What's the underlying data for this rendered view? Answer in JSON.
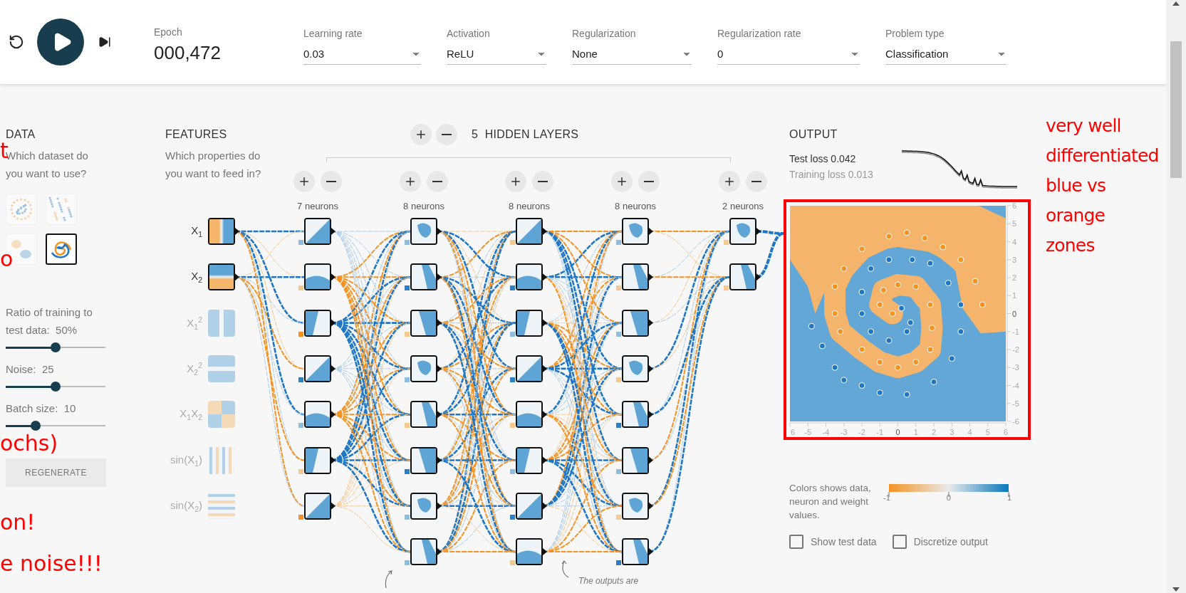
{
  "toolbar": {
    "epoch_label": "Epoch",
    "epoch": "000,472",
    "dropdowns": [
      {
        "label": "Learning rate",
        "value": "0.03"
      },
      {
        "label": "Activation",
        "value": "ReLU"
      },
      {
        "label": "Regularization",
        "value": "None"
      },
      {
        "label": "Regularization rate",
        "value": "0"
      },
      {
        "label": "Problem type",
        "value": "Classification"
      }
    ]
  },
  "data_panel": {
    "title": "DATA",
    "question": "Which dataset do you want to use?",
    "datasets": [
      {
        "kind": "circle",
        "selected": false
      },
      {
        "kind": "xor",
        "selected": false
      },
      {
        "kind": "gauss",
        "selected": false
      },
      {
        "kind": "spiral",
        "selected": true
      }
    ],
    "sliders": [
      {
        "label": "Ratio of training to test data:",
        "value": "50%",
        "level": 0.5
      },
      {
        "label": "Noise:",
        "value": "25",
        "level": 0.5
      },
      {
        "label": "Batch size:",
        "value": "10",
        "level": 0.3
      }
    ],
    "regenerate": "REGENERATE"
  },
  "features": {
    "title": "FEATURES",
    "question": "Which properties do you want to feed in?",
    "items": [
      {
        "label": "X$_{1}$",
        "kind": "x1",
        "selected": true
      },
      {
        "label": "X$_{2}$",
        "kind": "x2",
        "selected": true
      },
      {
        "label": "X$_{1}$$^{2}$",
        "kind": "x1sq",
        "selected": false
      },
      {
        "label": "X$_{2}$$^{2}$",
        "kind": "x2sq",
        "selected": false
      },
      {
        "label": "X$_{1}$X$_{2}$",
        "kind": "x1x2",
        "selected": false
      },
      {
        "label": "sin(X$_{1}$)",
        "kind": "sinx1",
        "selected": false
      },
      {
        "label": "sin(X$_{2}$)",
        "kind": "sinx2",
        "selected": false
      }
    ]
  },
  "hidden_layers": {
    "count": "5",
    "title": "HIDDEN LAYERS",
    "layers": [
      {
        "neurons": "7 neurons",
        "nodes": [
          {
            "color": "#8fbde0"
          },
          {
            "color": "#f5c890"
          },
          {
            "color": "#f59322"
          },
          {
            "color": "#2f7fc1"
          },
          {
            "color": "#8fbde0"
          },
          {
            "color": "#f5c890"
          },
          {
            "color": "#f59322"
          }
        ]
      },
      {
        "neurons": "8 neurons",
        "nodes": [
          {
            "color": "#8fbde0"
          },
          {
            "color": "#2f7fc1"
          },
          {
            "color": "#f5c890"
          },
          {
            "color": "#8fbde0"
          },
          {
            "color": "#f5c890"
          },
          {
            "color": "#2f7fc1"
          },
          {
            "color": "#8fbde0"
          },
          {
            "color": "#8fbde0"
          }
        ]
      },
      {
        "neurons": "8 neurons",
        "nodes": [
          {
            "color": "#f5c890"
          },
          {
            "color": "#2f7fc1"
          },
          {
            "color": "#8fbde0"
          },
          {
            "color": "#2f7fc1"
          },
          {
            "color": "#f5c890"
          },
          {
            "color": "#8fbde0"
          },
          {
            "color": "#2f7fc1"
          },
          {
            "color": "#f5c890"
          }
        ]
      },
      {
        "neurons": "8 neurons",
        "nodes": [
          {
            "color": "#8fbde0"
          },
          {
            "color": "#f5c890"
          },
          {
            "color": "#8fbde0"
          },
          {
            "color": "#f5c890"
          },
          {
            "color": "#2f7fc1"
          },
          {
            "color": "#8fbde0"
          },
          {
            "color": "#f5c890"
          },
          {
            "color": "#2f7fc1"
          }
        ]
      },
      {
        "neurons": "2 neurons",
        "nodes": [
          {
            "color": "#f5c890"
          },
          {
            "color": "#f5c890"
          }
        ]
      }
    ],
    "note": "The outputs are"
  },
  "output": {
    "title": "OUTPUT",
    "test_loss": "Test loss 0.042",
    "training_loss": "Training loss 0.013",
    "chart_data": {
      "type": "scatter",
      "xlim": [
        -6,
        6
      ],
      "ylim": [
        -6,
        6
      ],
      "xticks": [
        {
          "value": -6,
          "label": "6"
        },
        -5,
        -4,
        -3,
        -2,
        -1,
        0,
        1,
        2,
        3,
        4,
        5,
        6
      ],
      "yticks": [
        -6,
        -5,
        -4,
        -3,
        -2,
        -1,
        0,
        1,
        2,
        3,
        4,
        5,
        6
      ],
      "series": [
        {
          "color": "#f59322",
          "x": [
            -0.3,
            -1,
            -0.8,
            0,
            1,
            1.8,
            1.9,
            1.8,
            1,
            0,
            -1,
            -2,
            -3.2,
            -3.5,
            -3.5,
            -3,
            -2,
            -0.5,
            0.5,
            1.5,
            2.5,
            3.5,
            4.3,
            4.7
          ],
          "values": [
            0,
            0.5,
            1.3,
            1.6,
            1.5,
            0.5,
            -0.8,
            -2,
            -2.7,
            -3,
            -2.7,
            -2,
            -1,
            0,
            1.5,
            2.5,
            3.6,
            4.3,
            4.5,
            4.2,
            3.7,
            3,
            1.8,
            0.5
          ]
        },
        {
          "color": "#1f77c4",
          "x": [
            0.2,
            0.7,
            0.5,
            -0.5,
            -1.5,
            -2,
            -2,
            -1.5,
            -0.5,
            0.8,
            1.8,
            2.8,
            3.5,
            3.5,
            3,
            2,
            0.5,
            -1,
            -2,
            -3,
            -3.5,
            -4.2,
            -4.8
          ],
          "values": [
            0.3,
            -0.5,
            -1,
            -1.5,
            -1,
            0,
            1.2,
            2.5,
            3,
            3,
            2.8,
            1.7,
            0.5,
            -1,
            -2.5,
            -3.8,
            -4.5,
            -4.4,
            -4,
            -3.7,
            -3,
            -1.8,
            -0.7
          ]
        }
      ]
    },
    "legend": {
      "text": "Colors shows data, neuron and weight values.",
      "ticks": [
        "-1",
        "0",
        "1"
      ]
    },
    "checkboxes": [
      {
        "label": "Show test data",
        "checked": false
      },
      {
        "label": "Discretize output",
        "checked": false
      }
    ]
  },
  "annotations": {
    "left_fragments": [
      "t",
      "o",
      "ochs)",
      "on!",
      "e noise!!!"
    ],
    "right_note": [
      "very well",
      "differentiated",
      "blue vs",
      "orange",
      "zones"
    ]
  }
}
